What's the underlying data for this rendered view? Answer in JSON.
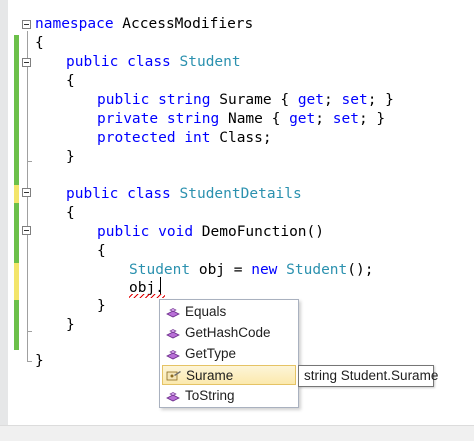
{
  "code": {
    "l1": {
      "kw": "namespace",
      "rest": " AccessModifiers"
    },
    "l2": {
      "text": "{"
    },
    "l3": {
      "kw1": "public",
      "kw2": "class",
      "ty": "Student"
    },
    "l4": {
      "text": "{"
    },
    "l5": {
      "kw1": "public",
      "kw2": "string",
      "rest": " Surame { ",
      "kw3": "get",
      "mid": "; ",
      "kw4": "set",
      "end": "; }"
    },
    "l6": {
      "kw1": "private",
      "kw2": "string",
      "rest": " Name { ",
      "kw3": "get",
      "mid": "; ",
      "kw4": "set",
      "end": "; }"
    },
    "l7": {
      "kw1": "protected",
      "kw2": "int",
      "rest": " Class;"
    },
    "l8": {
      "text": "}"
    },
    "l9": {
      "kw1": "public",
      "kw2": "class",
      "ty": "StudentDetails"
    },
    "l10": {
      "text": "{"
    },
    "l11": {
      "kw1": "public",
      "kw2": "void",
      "rest": " DemoFunction()"
    },
    "l12": {
      "text": "{"
    },
    "l13": {
      "ty1": "Student",
      "rest": " obj = ",
      "kw": "new",
      "ty2": "Student",
      "end": "();"
    },
    "l14": {
      "text": "obj."
    },
    "l15": {
      "text": "}"
    },
    "l16": {
      "text": "}"
    },
    "l17": {
      "text": "}"
    }
  },
  "completion": {
    "items": [
      {
        "label": "Equals",
        "icon": "method-icon"
      },
      {
        "label": "GetHashCode",
        "icon": "method-icon"
      },
      {
        "label": "GetType",
        "icon": "method-icon"
      },
      {
        "label": "Surame",
        "icon": "property-icon",
        "selected": true
      },
      {
        "label": "ToString",
        "icon": "method-icon"
      }
    ]
  },
  "tooltip": {
    "text": "string Student.Surame"
  },
  "colors": {
    "keyword": "#0000ff",
    "type": "#2b91af",
    "change_saved": "#6cc04a",
    "change_unsaved": "#f3e56b",
    "selection_border": "#e5c365"
  }
}
